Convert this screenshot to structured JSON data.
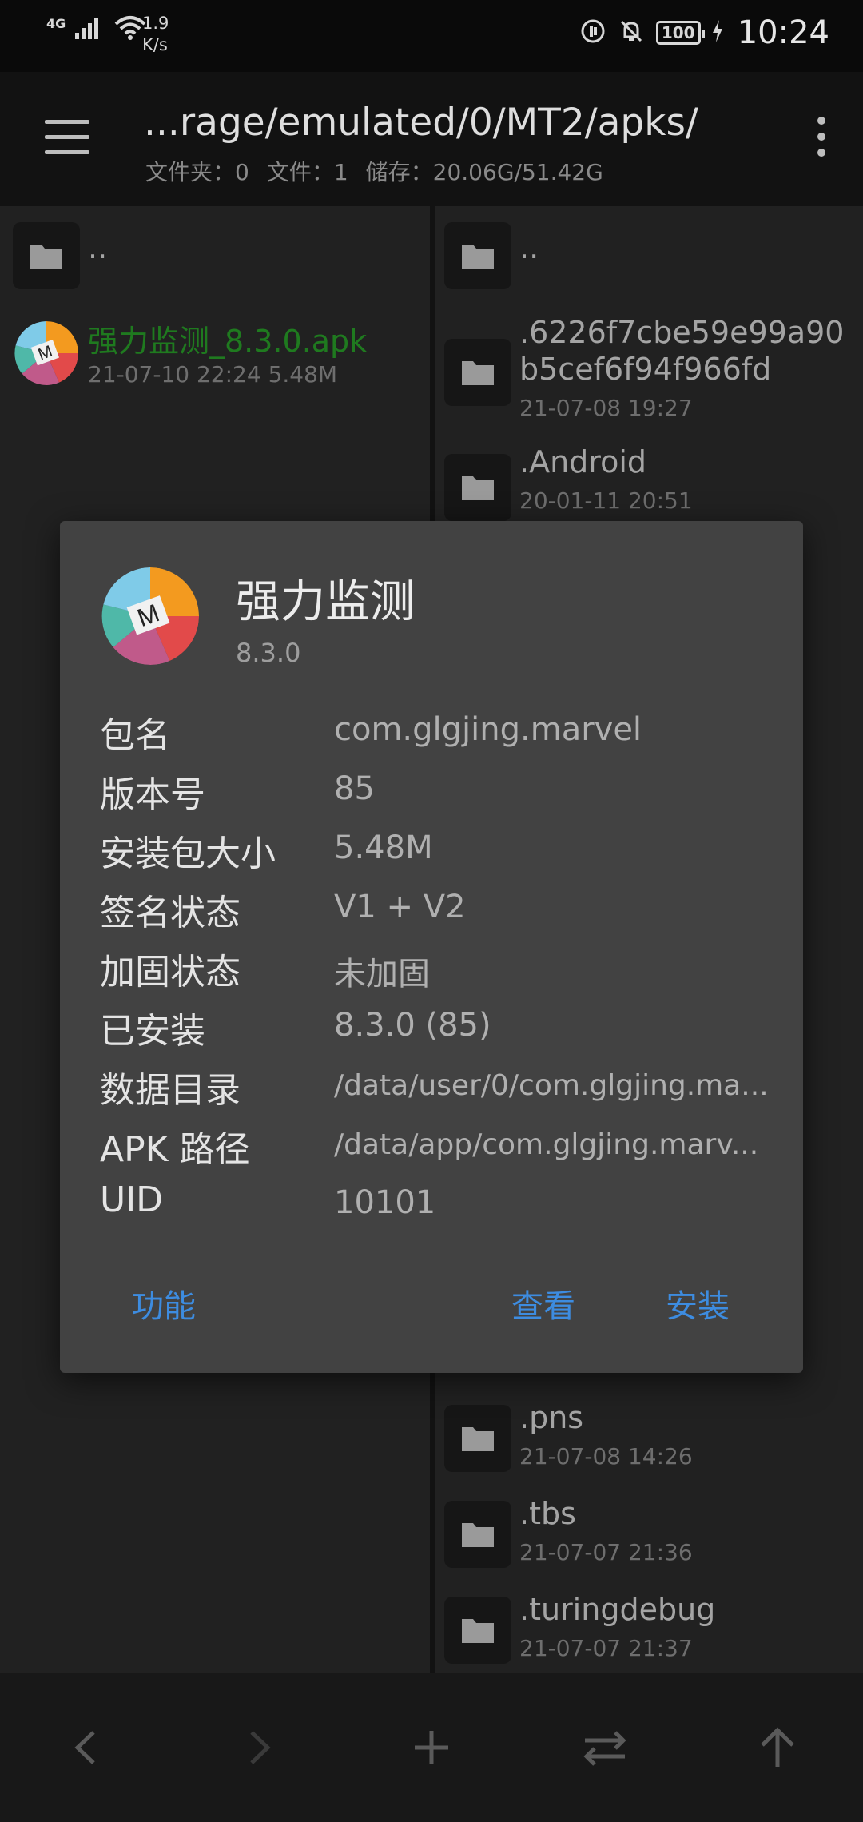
{
  "status_bar": {
    "network": "4G",
    "speed_value": "1.9",
    "speed_unit": "K/s",
    "battery": "100",
    "time": "10:24"
  },
  "app_bar": {
    "path": "...rage/emulated/0/MT2/apks/",
    "folders_label": "文件夹：0",
    "files_label": "文件：1",
    "storage_label": "储存：20.06G/51.42G"
  },
  "left_pane": {
    "parent_label": "..",
    "apk_file": {
      "name": "强力监测_8.3.0.apk",
      "meta": "21-07-10 22:24  5.48M"
    }
  },
  "right_pane": {
    "parent_label": "..",
    "items": [
      {
        "name_line1": ".6226f7cbe59e99a90",
        "name_line2": "b5cef6f94f966fd",
        "date": "21-07-08 19:27"
      },
      {
        "name": ".Android",
        "date": "20-01-11 20:51"
      },
      {
        "name": ".pns",
        "date": "21-07-08 14:26"
      },
      {
        "name": ".tbs",
        "date": "21-07-07 21:36"
      },
      {
        "name": ".turingdebug",
        "date": "21-07-07 21:37"
      }
    ]
  },
  "dialog": {
    "app_name": "强力监测",
    "version": "8.3.0",
    "rows": [
      {
        "label": "包名",
        "value": "com.glgjing.marvel"
      },
      {
        "label": "版本号",
        "value": "85"
      },
      {
        "label": "安装包大小",
        "value": "5.48M"
      },
      {
        "label": "签名状态",
        "value": "V1 + V2"
      },
      {
        "label": "加固状态",
        "value": "未加固"
      },
      {
        "label": "已安装",
        "value": "8.3.0 (85)"
      },
      {
        "label": "数据目录",
        "value": "/data/user/0/com.glgjing.ma..."
      },
      {
        "label": "APK 路径",
        "value": "/data/app/com.glgjing.marv..."
      },
      {
        "label": "UID",
        "value": "10101"
      }
    ],
    "buttons": {
      "function": "功能",
      "view": "查看",
      "install": "安装"
    }
  },
  "icons": {
    "menu": "hamburger-menu-icon",
    "more": "more-vertical-icon",
    "folder": "folder-icon",
    "back": "chevron-left-icon",
    "forward": "chevron-right-icon",
    "add": "plus-icon",
    "swap": "swap-icon",
    "up": "arrow-up-icon"
  },
  "colors": {
    "accent": "#3d8ce0",
    "apk_name": "#1f7a1f"
  }
}
